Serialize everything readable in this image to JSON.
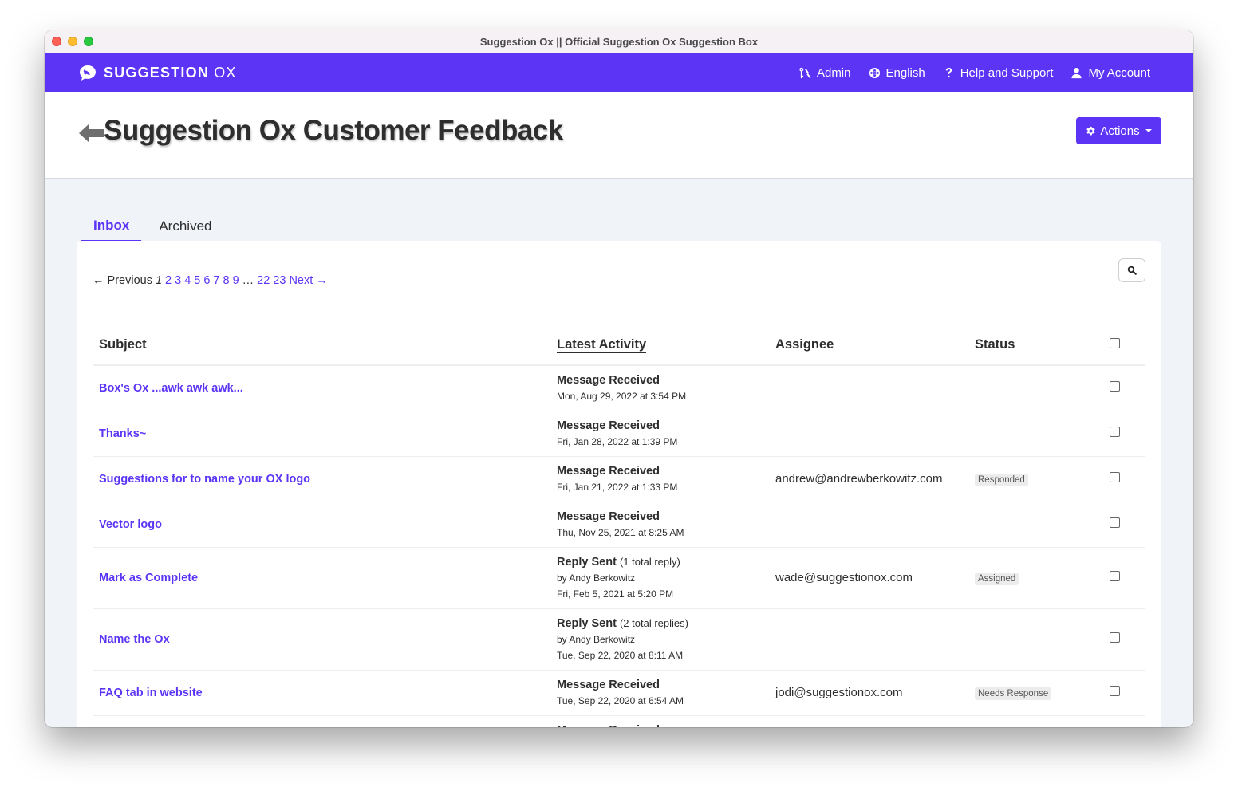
{
  "window": {
    "title": "Suggestion Ox || Official Suggestion Ox Suggestion Box"
  },
  "navbar": {
    "brand_bold": "SUGGESTION",
    "brand_light": "OX",
    "links": [
      {
        "label": "Admin",
        "icon": "admin-key-icon"
      },
      {
        "label": "English",
        "icon": "globe-icon"
      },
      {
        "label": "Help and Support",
        "icon": "question-icon"
      },
      {
        "label": "My Account",
        "icon": "user-icon"
      }
    ],
    "accent_color": "#5b34f5"
  },
  "header": {
    "title": "Suggestion Ox Customer Feedback",
    "actions_label": "Actions"
  },
  "tabs": [
    {
      "label": "Inbox",
      "active": true
    },
    {
      "label": "Archived",
      "active": false
    }
  ],
  "pager": {
    "previous": "← Previous",
    "current": "1",
    "pages": [
      "2",
      "3",
      "4",
      "5",
      "6",
      "7",
      "8",
      "9"
    ],
    "ellipsis": "…",
    "tail_pages": [
      "22",
      "23"
    ],
    "next": "Next →"
  },
  "table": {
    "columns": [
      "Subject",
      "Latest Activity",
      "Assignee",
      "Status"
    ],
    "rows": [
      {
        "subject": "Box's Ox ...awk awk awk...",
        "activity": "Message Received",
        "note": "",
        "by": "",
        "date": "Mon, Aug 29, 2022 at 3:54 PM",
        "assignee": "",
        "status": ""
      },
      {
        "subject": "Thanks~",
        "activity": "Message Received",
        "note": "",
        "by": "",
        "date": "Fri, Jan 28, 2022 at 1:39 PM",
        "assignee": "",
        "status": ""
      },
      {
        "subject": "Suggestions for to name your OX logo",
        "activity": "Message Received",
        "note": "",
        "by": "",
        "date": "Fri, Jan 21, 2022 at 1:33 PM",
        "assignee": "andrew@andrewberkowitz.com",
        "status": "Responded"
      },
      {
        "subject": "Vector logo",
        "activity": "Message Received",
        "note": "",
        "by": "",
        "date": "Thu, Nov 25, 2021 at 8:25 AM",
        "assignee": "",
        "status": ""
      },
      {
        "subject": "Mark as Complete",
        "activity": "Reply Sent",
        "note": "(1 total reply)",
        "by": "by Andy Berkowitz",
        "date": "Fri, Feb 5, 2021 at 5:20 PM",
        "assignee": "wade@suggestionox.com",
        "status": "Assigned"
      },
      {
        "subject": "Name the Ox",
        "activity": "Reply Sent",
        "note": "(2 total replies)",
        "by": "by Andy Berkowitz",
        "date": "Tue, Sep 22, 2020 at 8:11 AM",
        "assignee": "",
        "status": ""
      },
      {
        "subject": "FAQ tab in website",
        "activity": "Message Received",
        "note": "",
        "by": "",
        "date": "Tue, Sep 22, 2020 at 6:54 AM",
        "assignee": "jodi@suggestionox.com",
        "status": "Needs Response"
      },
      {
        "subject": "",
        "activity": "Message Received",
        "note": "",
        "by": "",
        "date": "",
        "assignee": "",
        "status": ""
      }
    ]
  }
}
